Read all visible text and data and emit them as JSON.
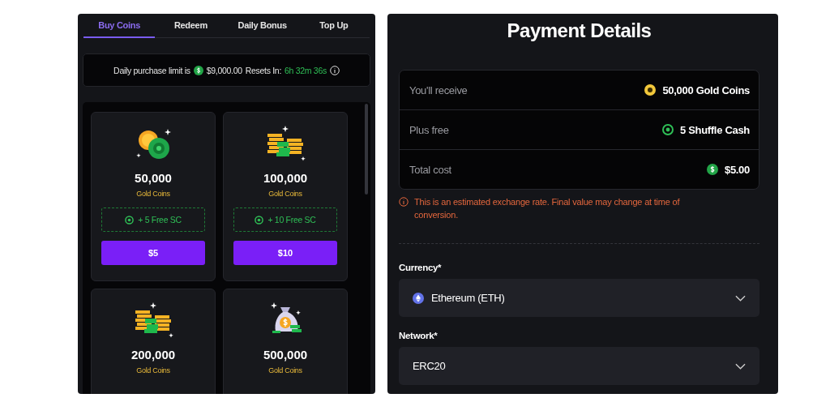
{
  "tabs": [
    {
      "label": "Buy Coins",
      "selected": true
    },
    {
      "label": "Redeem",
      "selected": false
    },
    {
      "label": "Daily Bonus",
      "selected": false
    },
    {
      "label": "Top Up",
      "selected": false
    }
  ],
  "limit": {
    "text": "Daily purchase limit is",
    "amount": "$9,000.00",
    "resets_label": "Resets In:",
    "resets_time": "6h 32m 36s"
  },
  "packages": [
    {
      "kind": "pair",
      "amount": "50,000",
      "unit": "Gold Coins",
      "bonus": "+ 5 Free SC",
      "price": "$5"
    },
    {
      "kind": "stacks",
      "amount": "100,000",
      "unit": "Gold Coins",
      "bonus": "+ 10 Free SC",
      "price": "$10"
    },
    {
      "kind": "stacks",
      "amount": "200,000",
      "unit": "Gold Coins"
    },
    {
      "kind": "bag",
      "amount": "500,000",
      "unit": "Gold Coins"
    }
  ],
  "payment": {
    "title": "Payment Details",
    "rows": [
      {
        "label": "You'll receive",
        "value": "50,000 Gold Coins",
        "kind": "coins"
      },
      {
        "label": "Plus free",
        "value": "5 Shuffle Cash",
        "kind": "cash"
      },
      {
        "label": "Total cost",
        "value": "$5.00",
        "kind": "money"
      }
    ],
    "warning": "This is an estimated exchange rate. Final value may change at time of conversion.",
    "fields": [
      {
        "label": "Currency*",
        "value": "Ethereum (ETH)",
        "kind": "crypto"
      },
      {
        "label": "Network*",
        "value": "ERC20"
      }
    ]
  }
}
